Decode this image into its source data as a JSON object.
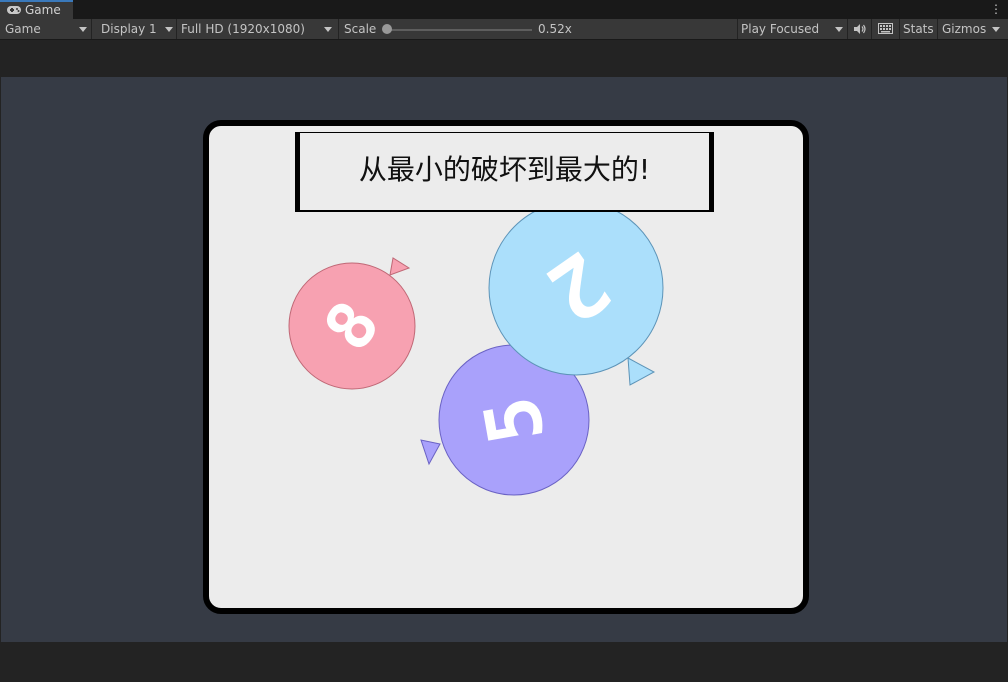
{
  "tab": {
    "title": "Game",
    "icon": "gamepad-icon"
  },
  "toolbar": {
    "view_mode": "Game",
    "display": "Display 1",
    "resolution": "Full HD (1920x1080)",
    "scale_label": "Scale",
    "scale_value": "0.52x",
    "play_mode": "Play Focused",
    "audio_icon": "speaker-icon",
    "keyboard_icon": "keyboard-icon",
    "stats": "Stats",
    "gizmos": "Gizmos",
    "more_icon": "kebab-menu-icon"
  },
  "game": {
    "banner_text": "从最小的破坏到最大的!",
    "balloons": [
      {
        "number": "8",
        "color": "#f7a1b1",
        "stroke": "#c06876"
      },
      {
        "number": "2",
        "color": "#abdffb",
        "stroke": "#5d94b8"
      },
      {
        "number": "5",
        "color": "#a9a1fb",
        "stroke": "#6a62c4"
      }
    ]
  }
}
